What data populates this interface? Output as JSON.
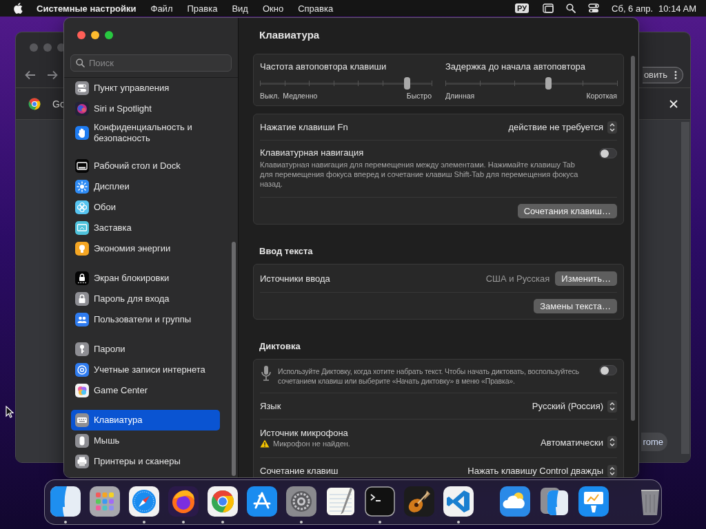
{
  "menu_bar": {
    "app_name": "Системные настройки",
    "menus": [
      "Файл",
      "Правка",
      "Вид",
      "Окно",
      "Справка"
    ],
    "input_source": "РУ",
    "date": "Сб, 6 апр.",
    "time": "10:14 AM"
  },
  "browser_window": {
    "tab_title": "Go",
    "toolbar_button": "овить",
    "floating_button": "rome"
  },
  "settings_window": {
    "search": {
      "placeholder": "Поиск"
    },
    "sidebar": {
      "groups": [
        [
          {
            "label": "Пункт управления",
            "selected": false
          },
          {
            "label": "Siri и Spotlight",
            "selected": false
          },
          {
            "label": "Конфиденциальность и безопасность",
            "selected": false
          }
        ],
        [
          {
            "label": "Рабочий стол и Dock",
            "selected": false
          },
          {
            "label": "Дисплеи",
            "selected": false
          },
          {
            "label": "Обои",
            "selected": false
          },
          {
            "label": "Заставка",
            "selected": false
          },
          {
            "label": "Экономия энергии",
            "selected": false
          }
        ],
        [
          {
            "label": "Экран блокировки",
            "selected": false
          },
          {
            "label": "Пароль для входа",
            "selected": false
          },
          {
            "label": "Пользователи и группы",
            "selected": false
          }
        ],
        [
          {
            "label": "Пароли",
            "selected": false
          },
          {
            "label": "Учетные записи интернета",
            "selected": false
          },
          {
            "label": "Game Center",
            "selected": false
          }
        ],
        [
          {
            "label": "Клавиатура",
            "selected": true
          },
          {
            "label": "Мышь",
            "selected": false
          },
          {
            "label": "Принтеры и сканеры",
            "selected": false
          }
        ]
      ]
    },
    "content": {
      "title": "Клавиатура",
      "sections": [
        {
          "rows": [
            {
              "kind": "sliders",
              "sliders": [
                {
                  "label": "Частота автоповтора клавиши",
                  "level": 0.857,
                  "scale": [
                    "Выкл.",
                    "Медленно",
                    "Быстро"
                  ]
                },
                {
                  "label": "Задержка до начала автоповтора",
                  "level": 0.6,
                  "scale": [
                    "Длинная",
                    "Короткая"
                  ]
                }
              ]
            }
          ]
        },
        {
          "rows": [
            {
              "kind": "popup",
              "label": "Нажатие клавиши Fn",
              "value": "действие не требуется"
            },
            {
              "kind": "toggle",
              "label": "Клавиатурная навигация",
              "description": "Клавиатурная навигация для перемещения между элементами. Нажимайте клавишу Tab для перемещения фокуса вперед и сочетание клавиш Shift-Tab для перемещения фокуса назад.",
              "on": false
            },
            {
              "kind": "button",
              "button": "Сочетания клавиш…"
            }
          ]
        },
        {
          "heading": "Ввод текста",
          "rows": [
            {
              "kind": "value_button",
              "label": "Источники ввода",
              "value": "США и Русская",
              "button": "Изменить…"
            },
            {
              "kind": "button",
              "button": "Замены текста…"
            }
          ]
        },
        {
          "heading": "Диктовка",
          "rows": [
            {
              "kind": "dictation",
              "description": "Используйте Диктовку, когда хотите набрать текст. Чтобы начать диктовать, воспользуйтесь сочетанием клавиш или выберите «Начать диктовку» в меню «Правка».",
              "on": false
            },
            {
              "kind": "popup",
              "label": "Язык",
              "value": "Русский (Россия)"
            },
            {
              "kind": "popup",
              "label": "Источник микрофона",
              "value": "Автоматически",
              "warning": "Микрофон не найден."
            },
            {
              "kind": "popup",
              "label": "Сочетание клавиш",
              "value": "Нажать клавишу Control дважды"
            }
          ]
        }
      ]
    }
  },
  "dock": {
    "groups": [
      [
        {
          "running": true
        },
        {
          "running": false
        },
        {
          "running": true
        },
        {
          "running": true
        },
        {
          "running": true
        },
        {
          "running": false
        },
        {
          "running": true
        },
        {
          "running": false
        },
        {
          "running": true
        },
        {
          "running": false
        },
        {
          "running": true
        }
      ],
      [
        {
          "running": false
        },
        {
          "running": false
        },
        {
          "running": false
        }
      ]
    ]
  }
}
